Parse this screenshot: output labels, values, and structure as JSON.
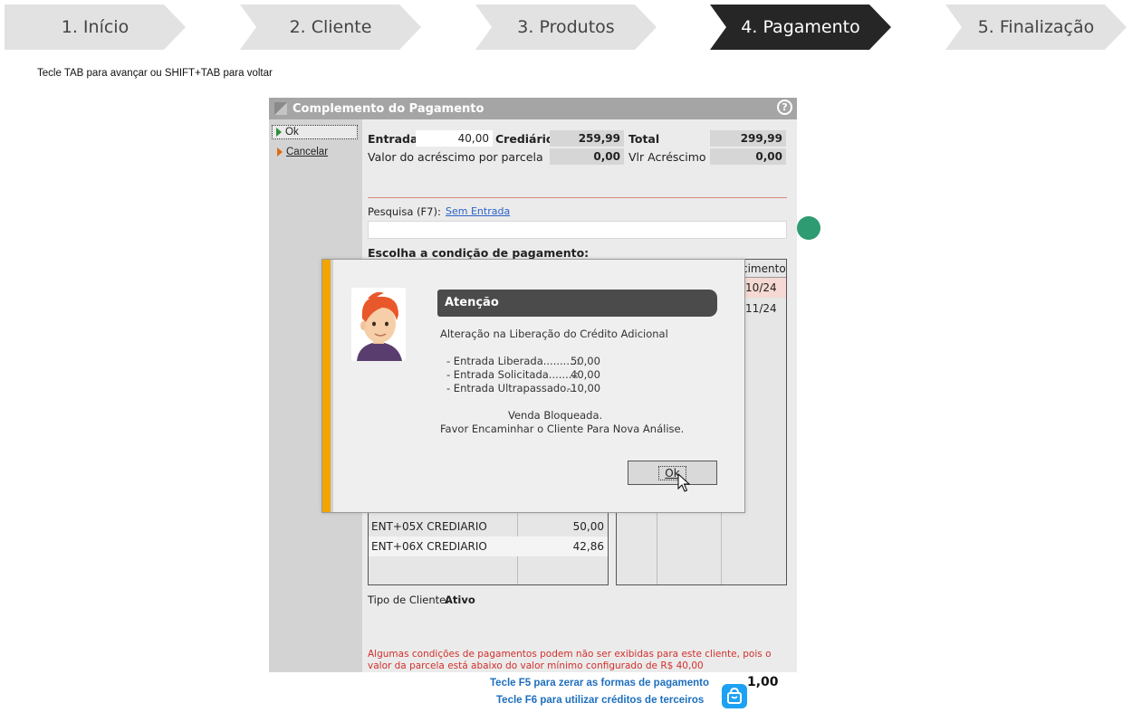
{
  "steps": [
    "1. Início",
    "2. Cliente",
    "3. Produtos",
    "4. Pagamento",
    "5. Finalização"
  ],
  "active_step": 3,
  "hint": "Tecle TAB para avançar ou SHIFT+TAB para voltar",
  "window": {
    "title": "Complemento do Pagamento",
    "help": "?",
    "sidebar": {
      "ok": "Ok",
      "cancel": "Cancelar"
    },
    "entrada_label": "Entrada",
    "entrada_value": "40,00",
    "crediario_label": "Crediário",
    "crediario_value": "259,99",
    "total_label": "Total",
    "total_value": "299,99",
    "acrescimo_parcela_label": "Valor do acréscimo por parcela",
    "acrescimo_parcela_value": "0,00",
    "vlr_acrescimo_label": "Vlr Acréscimo",
    "vlr_acrescimo_value": "0,00",
    "pesquisa_label": "Pesquisa (F7):",
    "sem_entrada": "Sem Entrada",
    "escolha_label": "Escolha a condição de pagamento:",
    "grid_right_header": "cimento",
    "grid_right_rows": [
      "/10/24",
      "/11/24"
    ],
    "rows": [
      {
        "name": "ENT+05X CREDIARIO",
        "value": "50,00"
      },
      {
        "name": "ENT+06X CREDIARIO",
        "value": "42,86"
      }
    ],
    "tipo_cliente_label": "Tipo de Cliente:",
    "tipo_cliente_value": "Ativo",
    "warning": "Algumas condições de pagamentos podem não ser exibidas para este cliente, pois o valor da parcela está abaixo do valor mínimo configurado de R$ 40,00"
  },
  "dialog": {
    "title": "Atenção",
    "line1": "Alteração na Liberação do Crédito Adicional",
    "items": [
      {
        "label": "- Entrada Liberada..........:",
        "value": "50,00"
      },
      {
        "label": "- Entrada Solicitada........:",
        "value": "40,00"
      },
      {
        "label": "- Entrada Ultrapassado..:",
        "value": "-10,00"
      }
    ],
    "line_blocked": "Venda Bloqueada.",
    "line_forward": "Favor Encaminhar o Cliente Para Nova Análise.",
    "ok": "Ok"
  },
  "footer": {
    "f5": "Tecle F5 para zerar as formas de pagamento",
    "f6": "Tecle F6 para utilizar créditos de terceiros",
    "amount": "1,00"
  },
  "colors": {
    "active_step": "#262626",
    "accent_orange": "#f2a400",
    "link": "#2a63c8",
    "warning": "#d0312d",
    "badge_green": "#2e9b72",
    "bag_blue": "#1da1f2"
  }
}
